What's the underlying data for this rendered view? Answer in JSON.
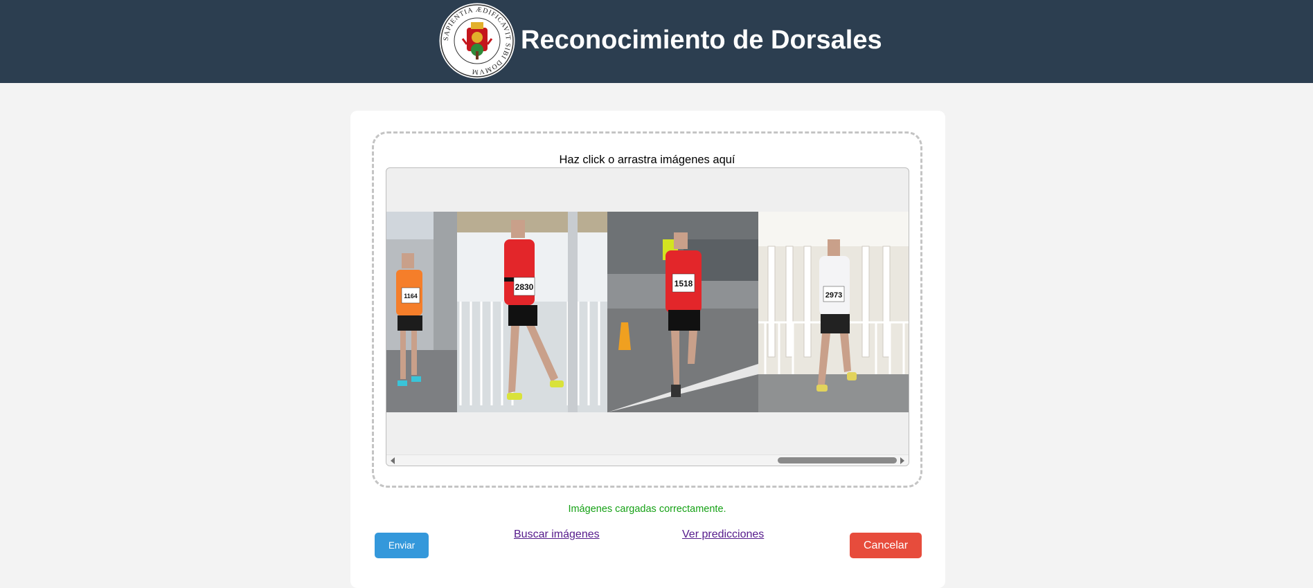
{
  "header": {
    "title": "Reconocimiento de Dorsales",
    "logo_icon": "university-seal-icon",
    "logo_text": "SAPIENTIA ÆDIFICAVIT SIBI DOMVM",
    "background_color": "#2c3e50"
  },
  "upload": {
    "prompt": "Haz click o arrastra imágenes aquí",
    "images": [
      {
        "alt": "Runner 1164",
        "bib": "1164"
      },
      {
        "alt": "Runner 2830",
        "bib": "2830"
      },
      {
        "alt": "Runner 1518",
        "bib": "1518"
      },
      {
        "alt": "Runner 2973",
        "bib": "2973"
      }
    ]
  },
  "status": {
    "message": "Imágenes cargadas correctamente.",
    "color": "#15a115"
  },
  "actions": {
    "send_label": "Enviar",
    "search_label": "Buscar imágenes",
    "predictions_label": "Ver predicciones",
    "cancel_label": "Cancelar",
    "send_color": "#3498db",
    "cancel_color": "#e74c3c"
  }
}
